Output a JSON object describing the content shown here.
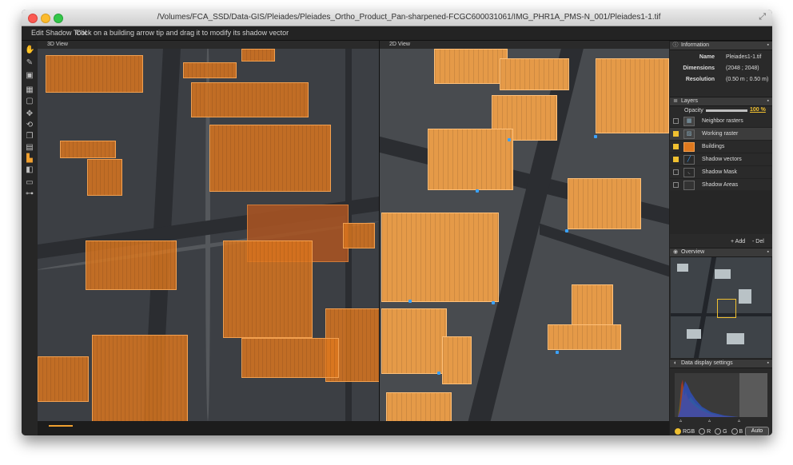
{
  "window": {
    "title": "/Volumes/FCA_SSD/Data-GIS/Pleiades/Pleiades_Ortho_Product_Pan-sharpened-FCGC600031061/IMG_PHR1A_PMS-N_001/Pleiades1-1.tif"
  },
  "toolbar": {
    "tool_name": "Edit Shadow Tool",
    "hint": "Click on a building arrow tip and drag it to modify its shadow vector"
  },
  "views": {
    "left_label": "3D View",
    "right_label": "2D View"
  },
  "panel": {
    "information": {
      "header": "Information",
      "rows": [
        {
          "key": "Name",
          "value": "Pleiades1-1.tif"
        },
        {
          "key": "Dimensions",
          "value": "(2048 ; 2048)"
        },
        {
          "key": "Resolution",
          "value": "(0.50 m ; 0.50 m)"
        }
      ]
    },
    "layers": {
      "header": "Layers",
      "opacity_label": "Opacity",
      "opacity_value": "100 %",
      "items": [
        {
          "name": "Neighbor rasters",
          "checked": false,
          "icon": "raster-grid-icon"
        },
        {
          "name": "Working raster",
          "checked": true,
          "icon": "image-icon"
        },
        {
          "name": "Buildings",
          "checked": true,
          "icon": "building-icon"
        },
        {
          "name": "Shadow vectors",
          "checked": true,
          "icon": "vector-line-icon"
        },
        {
          "name": "Shadow Mask",
          "checked": false,
          "icon": "mask-icon"
        },
        {
          "name": "Shadow Areas",
          "checked": false,
          "icon": "area-icon"
        }
      ],
      "add_label": "+ Add",
      "del_label": "- Del"
    },
    "overview": {
      "header": "Overview"
    },
    "data_display": {
      "header": "Data display settings",
      "channels": [
        "RGB",
        "R",
        "G",
        "B"
      ],
      "selected_channel": "RGB",
      "auto_label": "Auto"
    }
  },
  "colors": {
    "building_overlay": "#de781e",
    "accent": "#f0c030",
    "shadow_vector": "#3aa2ff"
  }
}
